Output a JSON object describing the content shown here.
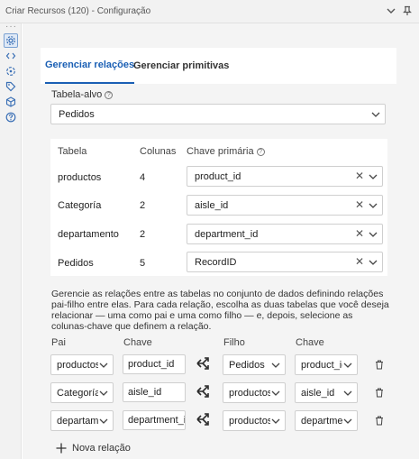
{
  "window": {
    "title": "Criar Recursos (120) - Configuração"
  },
  "tabs": [
    {
      "label": "Gerenciar relações"
    },
    {
      "label": "Gerenciar primitivas"
    }
  ],
  "target": {
    "label": "Tabela-alvo",
    "value": "Pedidos"
  },
  "table": {
    "headers": {
      "table": "Tabela",
      "columns": "Colunas",
      "key": "Chave primária"
    },
    "rows": [
      {
        "table": "productos",
        "columns": "4",
        "key": "product_id"
      },
      {
        "table": "Categoría",
        "columns": "2",
        "key": "aisle_id"
      },
      {
        "table": "departamento",
        "columns": "2",
        "key": "department_id"
      },
      {
        "table": "Pedidos",
        "columns": "5",
        "key": "RecordID"
      }
    ]
  },
  "description": "Gerencie as relações entre as tabelas no conjunto de dados definindo relações pai-filho entre elas. Para cada relação, escolha as duas tabelas que você deseja relacionar — uma como pai e uma como filho — e, depois, selecione as colunas-chave que definem a relação.",
  "relations": {
    "headers": {
      "parent": "Pai",
      "parent_key": "Chave",
      "child": "Filho",
      "child_key": "Chave"
    },
    "rows": [
      {
        "parent": "productos",
        "parent_key": "product_id",
        "child": "Pedidos",
        "child_key": "product_id"
      },
      {
        "parent": "Categoría",
        "parent_key": "aisle_id",
        "child": "productos",
        "child_key": "aisle_id"
      },
      {
        "parent": "departamento",
        "parent_key": "department_id",
        "child": "productos",
        "child_key": "department_id"
      }
    ],
    "new_label": "Nova relação"
  },
  "colors": {
    "accent": "#1a5fb4",
    "panel": "#f4f4f4"
  },
  "icons": [
    "settings-icon",
    "code-icon",
    "target-icon",
    "tag-icon",
    "cube-icon",
    "help-icon",
    "chevron-down-icon",
    "pin-icon",
    "clear-icon",
    "relation-arrows-icon",
    "trash-icon",
    "plus-icon"
  ]
}
